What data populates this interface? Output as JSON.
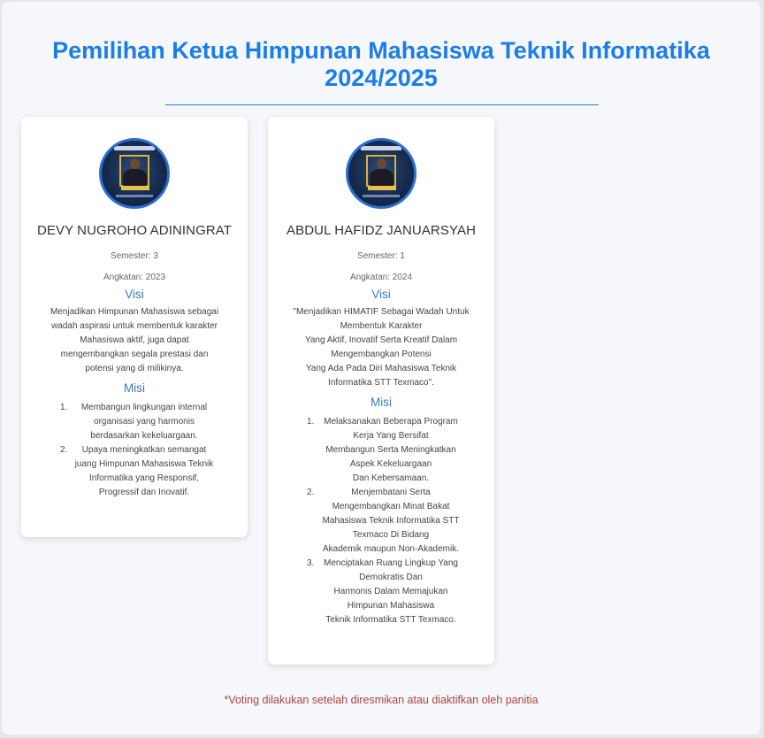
{
  "header": {
    "title_line1": "Pemilihan Ketua Himpunan Mahasiswa Teknik Informatika",
    "title_line2": "2024/2025"
  },
  "candidates": [
    {
      "name": "DEVY NUGROHO ADININGRAT",
      "semester": "Semester: 3",
      "angkatan": "Angkatan: 2023",
      "visi_label": "Visi",
      "visi_lines": [
        "Menjadikan Himpunan Mahasiswa sebagai",
        "wadah aspirasi untuk membentuk karakter",
        "Mahasiswa aktif, juga dapat",
        "mengembangkan segala prestasi dan",
        "potensi yang di milikinya."
      ],
      "misi_label": "Misi",
      "misi": [
        {
          "num": "1.",
          "lines": [
            "Membangun lingkungan internal",
            "organisasi yang harmonis",
            "berdasarkan kekeluargaan."
          ]
        },
        {
          "num": "2.",
          "lines": [
            "Upaya meningkatkan semangat",
            "juang Himpunan Mahasiswa Teknik",
            "Informatika yang Responsif,",
            "Progressif dan Inovatif."
          ]
        }
      ]
    },
    {
      "name": "ABDUL HAFIDZ JANUARSYAH",
      "semester": "Semester: 1",
      "angkatan": "Angkatan: 2024",
      "visi_label": "Visi",
      "visi_lines": [
        "\"Menjadikan HIMATIF Sebagai Wadah Untuk",
        "Membentuk Karakter",
        "Yang Aktif, Inovatif Serta Kreatif Dalam",
        "Mengembangkan Potensi",
        "Yang Ada Pada Diri Mahasiswa Teknik",
        "Informatika STT Texmaco\"."
      ],
      "misi_label": "Misi",
      "misi": [
        {
          "num": "1.",
          "lines": [
            "Melaksanakan Beberapa Program",
            "Kerja Yang Bersifat",
            "Membangun Serta Meningkatkan",
            "Aspek Kekeluargaan",
            "Dan Kebersamaan."
          ]
        },
        {
          "num": "2.",
          "lines": [
            "Menjembatani Serta",
            "Mengembangkan Minat Bakat",
            "Mahasiswa Teknik Informatika STT",
            "Texmaco Di Bidang",
            "Akademik maupun Non-Akademik."
          ]
        },
        {
          "num": "3.",
          "lines": [
            "Menciptakan Ruang Lingkup Yang",
            "Demokratis Dan",
            "Harmonis Dalam Memajukan",
            "Himpunan Mahasiswa",
            "Teknik Informatika STT Texmaco."
          ]
        }
      ]
    }
  ],
  "footer": {
    "note": "*Voting dilakukan setelah diresmikan atau diaktifkan oleh panitia"
  },
  "colors": {
    "title": "#1a7ee6",
    "subheading": "#3a78c0",
    "footer_note": "#a94442",
    "avatar_border": "#2c6fd3"
  }
}
